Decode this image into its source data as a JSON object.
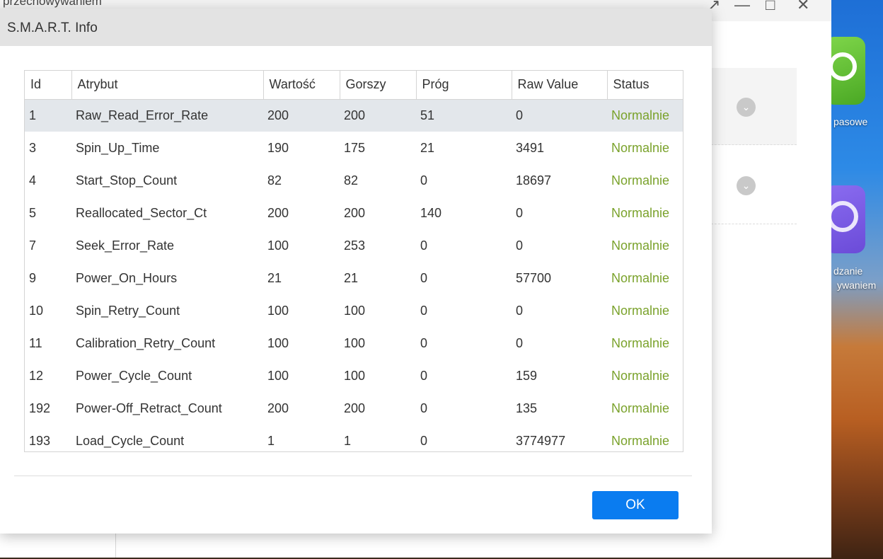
{
  "background_app": {
    "title_fragment": "przechowywaniem",
    "window_controls": [
      "↗",
      "—",
      "□",
      "✕"
    ]
  },
  "desktop": {
    "labels": [
      "pasowe",
      "dzanie",
      "ywaniem"
    ]
  },
  "dialog": {
    "title": "S.M.A.R.T. Info",
    "ok_label": "OK",
    "status_color": "#7aa22b",
    "ok_color": "#0a7cf0"
  },
  "table": {
    "columns": [
      "Id",
      "Atrybut",
      "Wartość",
      "Gorszy",
      "Próg",
      "Raw Value",
      "Status"
    ],
    "rows": [
      [
        "1",
        "Raw_Read_Error_Rate",
        "200",
        "200",
        "51",
        "0",
        "Normalnie"
      ],
      [
        "3",
        "Spin_Up_Time",
        "190",
        "175",
        "21",
        "3491",
        "Normalnie"
      ],
      [
        "4",
        "Start_Stop_Count",
        "82",
        "82",
        "0",
        "18697",
        "Normalnie"
      ],
      [
        "5",
        "Reallocated_Sector_Ct",
        "200",
        "200",
        "140",
        "0",
        "Normalnie"
      ],
      [
        "7",
        "Seek_Error_Rate",
        "100",
        "253",
        "0",
        "0",
        "Normalnie"
      ],
      [
        "9",
        "Power_On_Hours",
        "21",
        "21",
        "0",
        "57700",
        "Normalnie"
      ],
      [
        "10",
        "Spin_Retry_Count",
        "100",
        "100",
        "0",
        "0",
        "Normalnie"
      ],
      [
        "11",
        "Calibration_Retry_Count",
        "100",
        "100",
        "0",
        "0",
        "Normalnie"
      ],
      [
        "12",
        "Power_Cycle_Count",
        "100",
        "100",
        "0",
        "159",
        "Normalnie"
      ],
      [
        "192",
        "Power-Off_Retract_Count",
        "200",
        "200",
        "0",
        "135",
        "Normalnie"
      ],
      [
        "193",
        "Load_Cycle_Count",
        "1",
        "1",
        "0",
        "3774977",
        "Normalnie"
      ]
    ]
  }
}
